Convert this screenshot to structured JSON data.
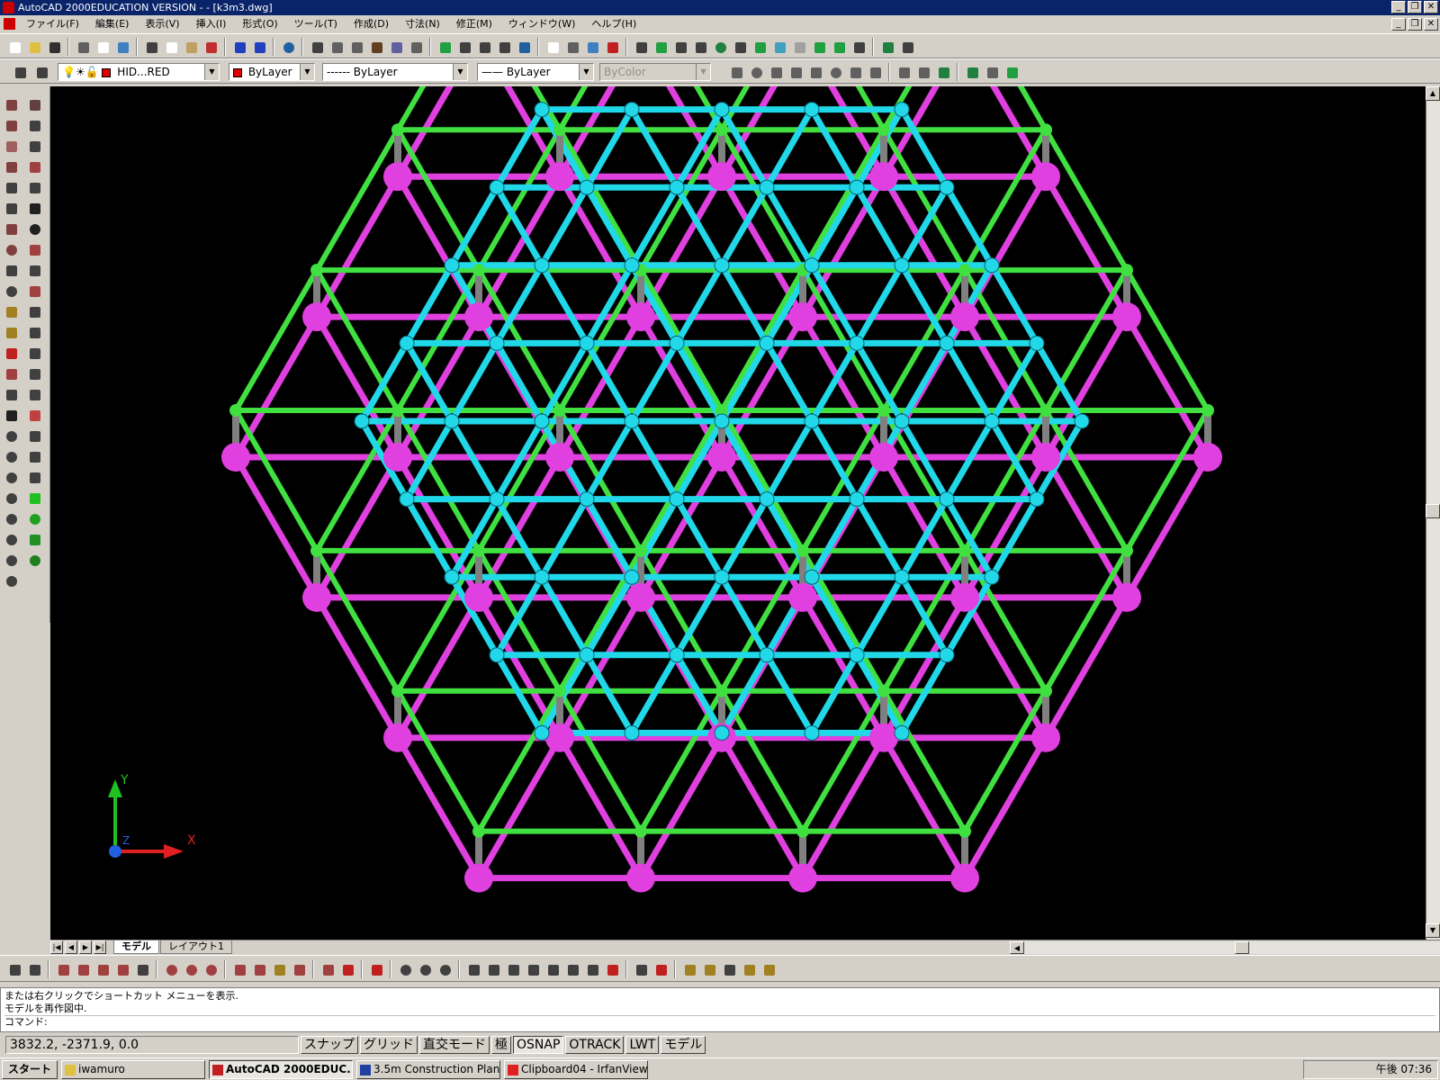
{
  "window": {
    "title": "AutoCAD 2000EDUCATION VERSION - - [k3m3.dwg]"
  },
  "menu": [
    "ファイル(F)",
    "編集(E)",
    "表示(V)",
    "挿入(I)",
    "形式(O)",
    "ツール(T)",
    "作成(D)",
    "寸法(N)",
    "修正(M)",
    "ウィンドウ(W)",
    "ヘルプ(H)"
  ],
  "properties": {
    "layer": "HID...RED",
    "color": "ByLayer",
    "linetype": "------ ByLayer",
    "lineweight": "—— ByLayer",
    "plotstyle": "ByColor"
  },
  "tabs": {
    "model": "モデル",
    "layout": "レイアウト1"
  },
  "command": {
    "line1": "または右クリックでショートカット メニューを表示.",
    "line2": "モデルを再作図中.",
    "prompt": "コマンド:"
  },
  "status": {
    "coords": "3832.2, -2371.9, 0.0",
    "snap": "スナップ",
    "grid": "グリッド",
    "ortho": "直交モード",
    "polar": "極",
    "osnap": "OSNAP",
    "otrack": "OTRACK",
    "lwt": "LWT",
    "model": "モデル"
  },
  "ucs": {
    "x": "X",
    "y": "Y",
    "z": "Z"
  },
  "taskbar": {
    "start": "スタート",
    "items": [
      "iwamuro",
      "AutoCAD 2000EDUC...",
      "3.5m Construction Plan -...",
      "Clipboard04 - IrfanView"
    ],
    "clock": "午後 07:36"
  },
  "colors": {
    "magenta": "#e040e0",
    "green": "#40e040",
    "cyan": "#20d8e8",
    "grey": "#808080",
    "background": "#000000"
  }
}
